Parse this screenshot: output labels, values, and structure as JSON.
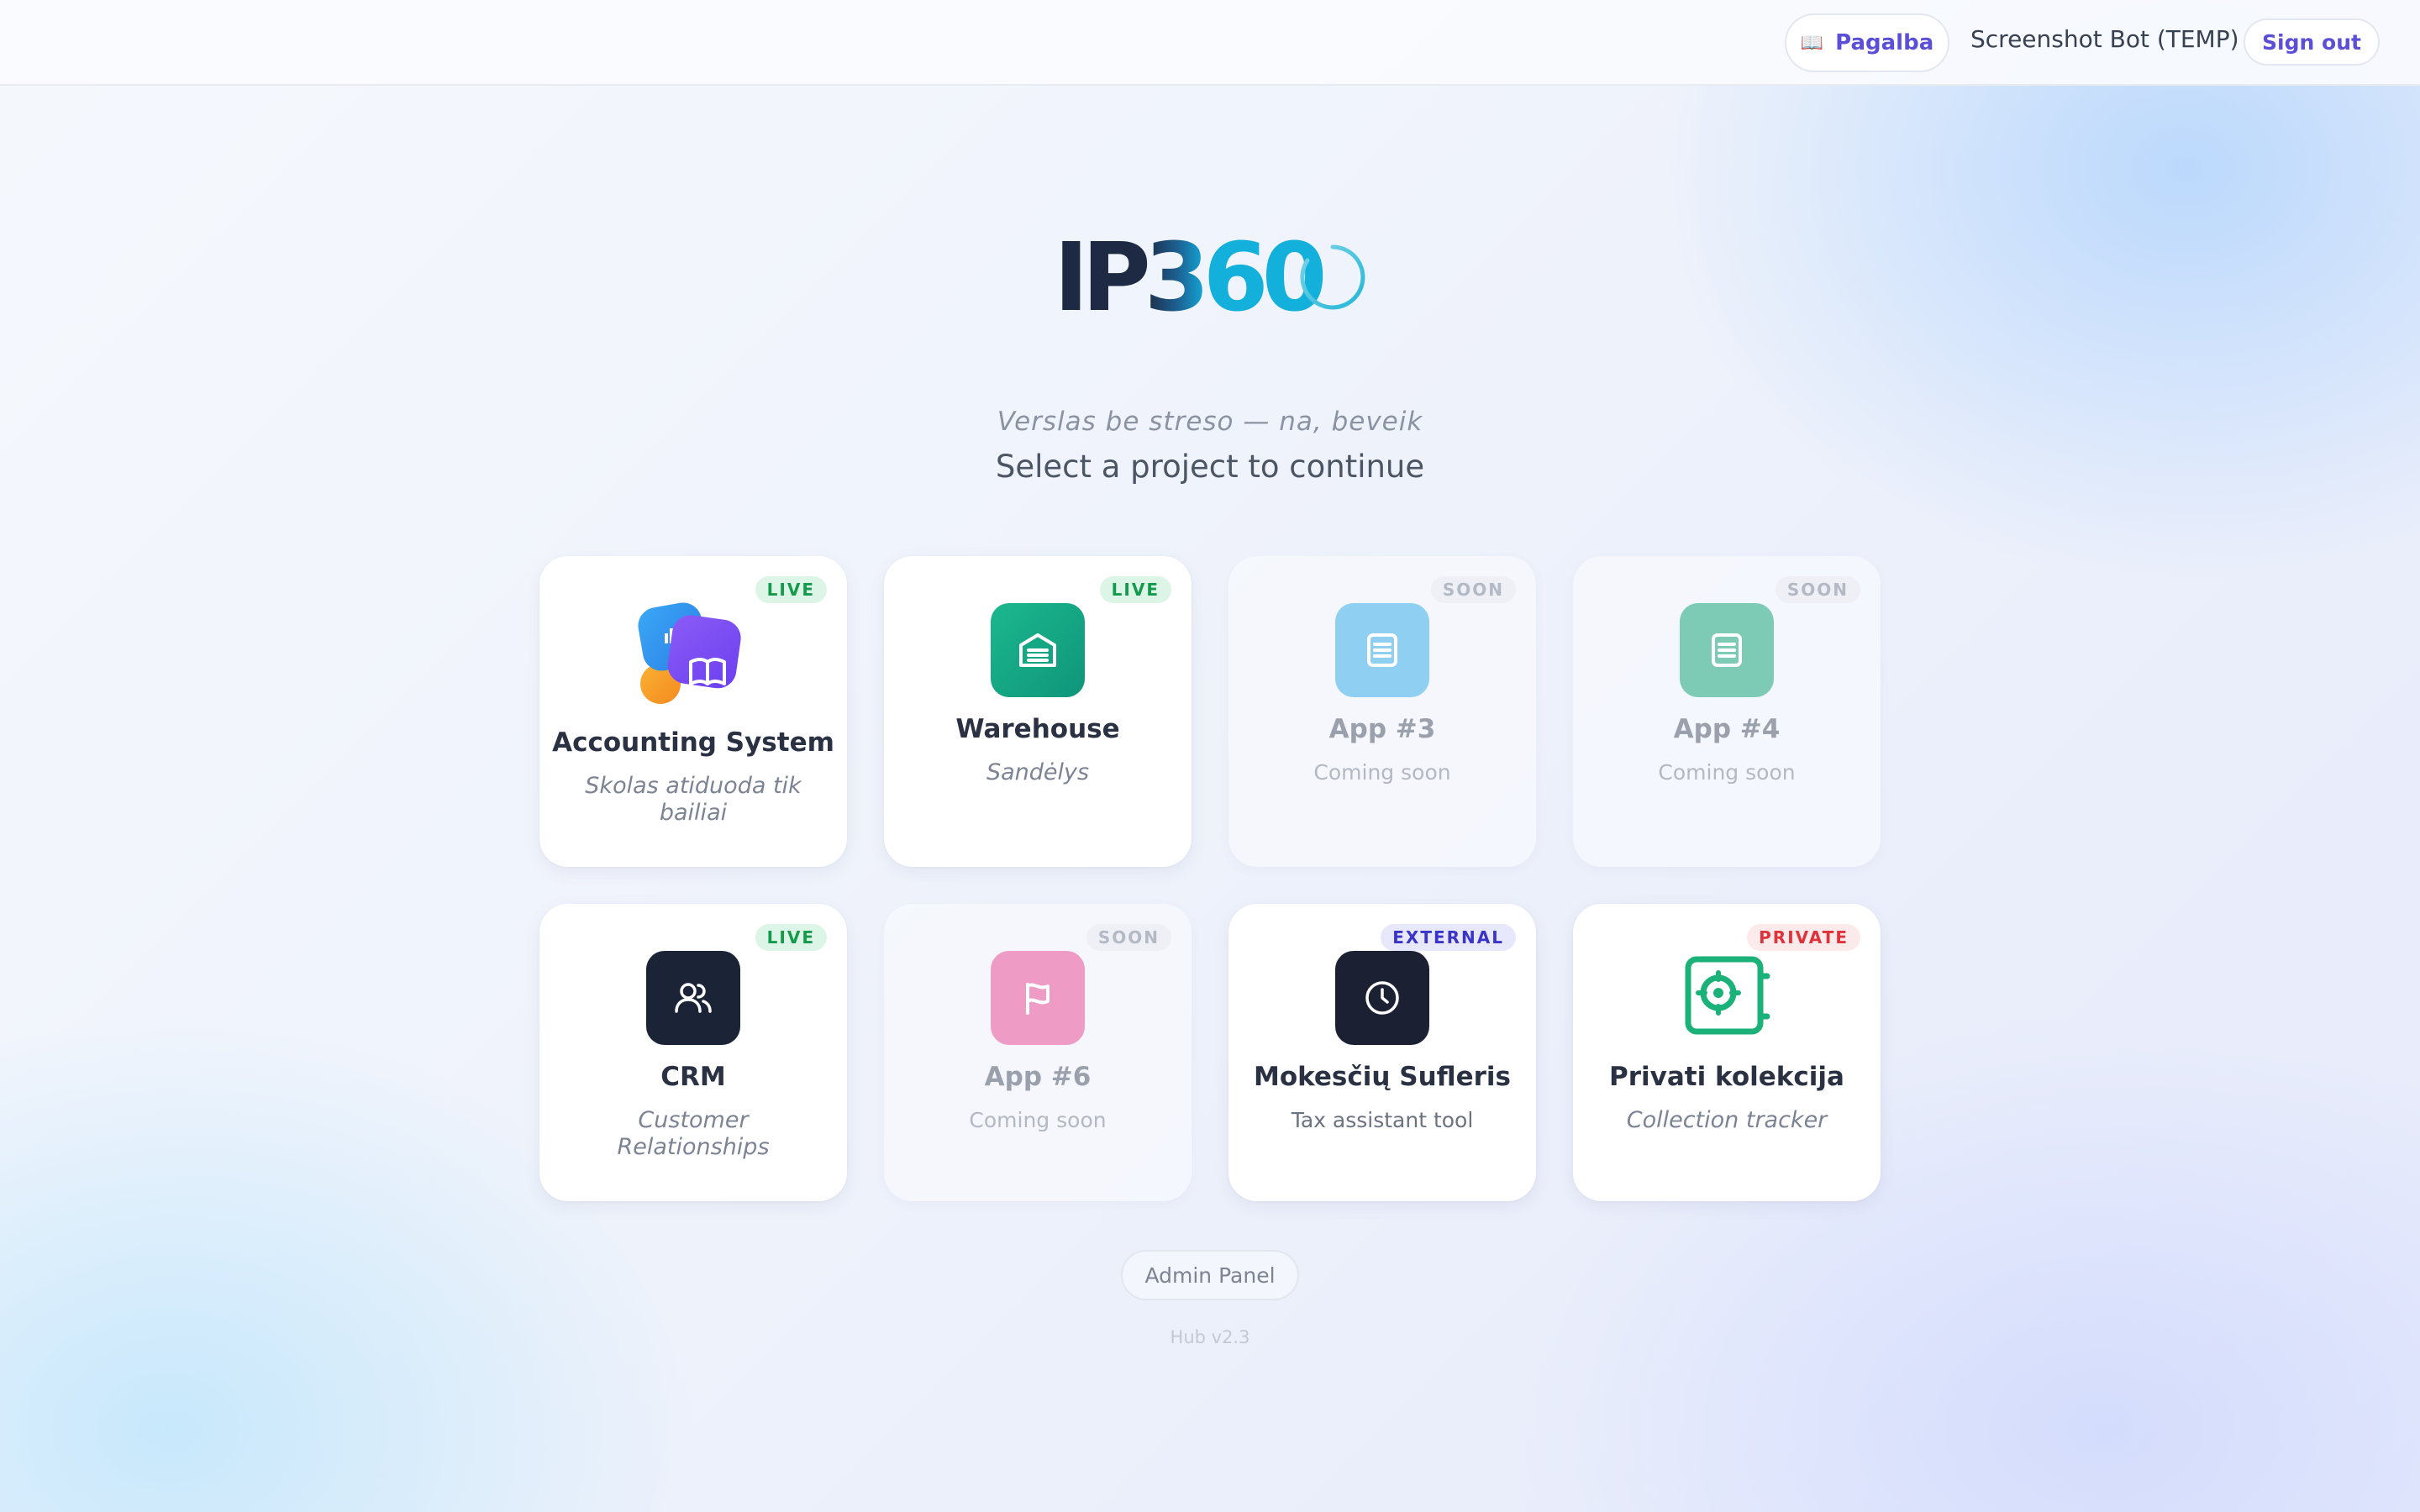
{
  "header": {
    "help_label": "Pagalba",
    "help_icon": "open-book-icon",
    "user_name": "Screenshot Bot (TEMP)",
    "signout_label": "Sign out"
  },
  "logo": {
    "part1": "IP",
    "part2": "3",
    "part3": "60"
  },
  "tagline": "Verslas be streso — na, beveik",
  "subtitle": "Select a project to continue",
  "cards": [
    {
      "title": "Accounting System",
      "description": "Skolas atiduoda tik bailiai",
      "badge": "LIVE",
      "status": "live",
      "icon": "accounting-app-icon"
    },
    {
      "title": "Warehouse",
      "description": "Sandėlys",
      "badge": "LIVE",
      "status": "live",
      "icon": "warehouse-icon",
      "color": "#14a37f"
    },
    {
      "title": "App #3",
      "description": "Coming soon",
      "badge": "SOON",
      "status": "soon",
      "icon": "document-icon",
      "color": "#8fd0f2"
    },
    {
      "title": "App #4",
      "description": "Coming soon",
      "badge": "SOON",
      "status": "soon",
      "icon": "document-icon",
      "color": "#7dcbb5"
    },
    {
      "title": "CRM",
      "description": "Customer Relationships",
      "badge": "LIVE",
      "status": "live",
      "icon": "users-icon",
      "color": "#1b2436"
    },
    {
      "title": "App #6",
      "description": "Coming soon",
      "badge": "SOON",
      "status": "soon",
      "icon": "flag-icon",
      "color": "#ee9cc6"
    },
    {
      "title": "Mokesčių Sufleris",
      "description": "Tax assistant tool",
      "badge": "EXTERNAL",
      "status": "external",
      "icon": "clock-icon",
      "color": "#1b2033"
    },
    {
      "title": "Privati kolekcija",
      "description": "Collection tracker",
      "badge": "PRIVATE",
      "status": "private",
      "icon": "safe-icon",
      "color": "#1bb27a"
    }
  ],
  "footer": {
    "admin_label": "Admin Panel",
    "version": "Hub v2.3"
  },
  "colors": {
    "accent": "#5b4fd8",
    "logo_dark": "#1e2a44",
    "logo_blue": "#13b0dc",
    "live": "#139a4c",
    "external": "#3b34c8",
    "private": "#e0323a"
  }
}
